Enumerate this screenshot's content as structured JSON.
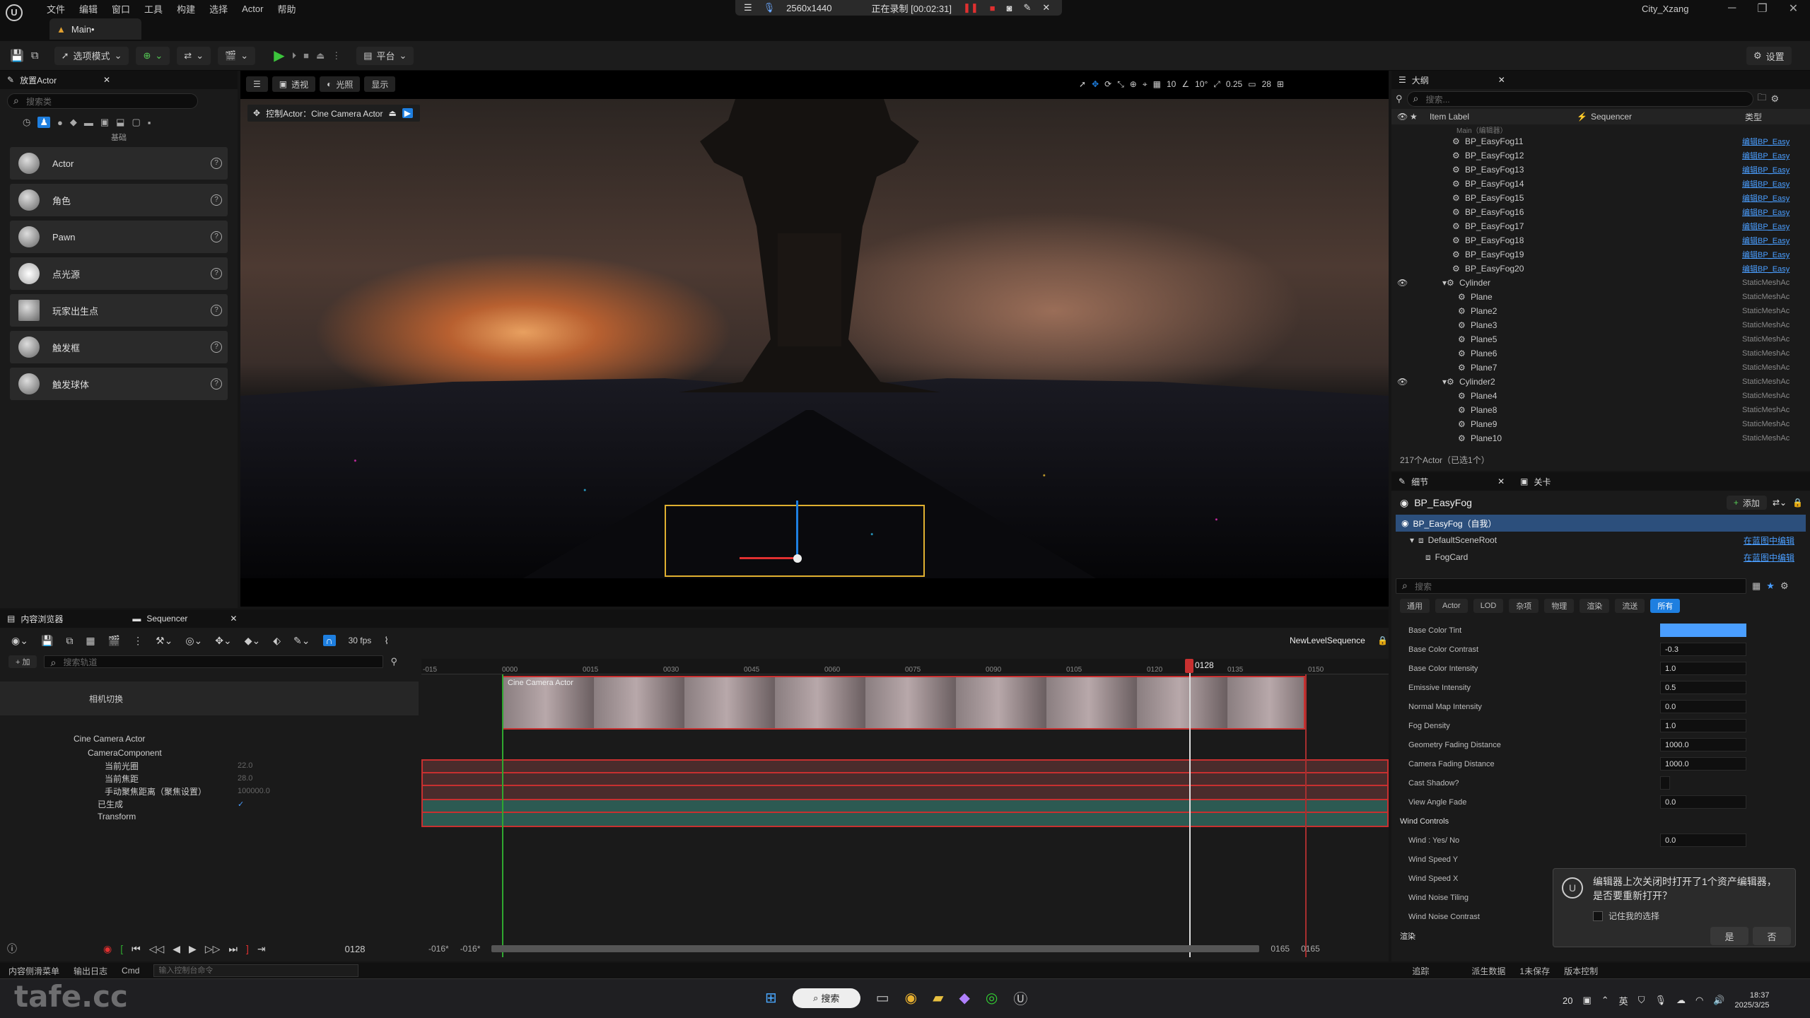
{
  "title_bar": {
    "menu": [
      "文件",
      "编辑",
      "窗口",
      "工具",
      "构建",
      "选择",
      "Actor",
      "帮助"
    ],
    "tab": "Main•",
    "recording": {
      "resolution": "2560x1440",
      "status": "正在录制 [00:02:31]"
    },
    "project": "City_Xzang"
  },
  "toolbar": {
    "mode": "选项模式",
    "platform": "平台",
    "settings": "设置"
  },
  "place_actors": {
    "tab": "放置Actor",
    "search_placeholder": "搜索类",
    "category": "基础",
    "items": [
      {
        "label": "Actor"
      },
      {
        "label": "角色"
      },
      {
        "label": "Pawn"
      },
      {
        "label": "点光源"
      },
      {
        "label": "玩家出生点"
      },
      {
        "label": "触发框"
      },
      {
        "label": "触发球体"
      }
    ]
  },
  "viewport": {
    "perspective": "透视",
    "lit": "光照",
    "show": "显示",
    "pilot": "控制Actor：Cine Camera Actor",
    "grid": "10",
    "angle": "10°",
    "scale": "0.25",
    "speed": "28"
  },
  "outliner": {
    "tab": "大纲",
    "search_placeholder": "搜索...",
    "col_label": "Item Label",
    "col_seq": "Sequencer",
    "col_type": "类型",
    "group": "Main（编辑器）",
    "rows": [
      {
        "name": "BP_EasyFog11",
        "type": "编辑BP_Easy",
        "link": true,
        "indent": 2
      },
      {
        "name": "BP_EasyFog12",
        "type": "编辑BP_Easy",
        "link": true,
        "indent": 2
      },
      {
        "name": "BP_EasyFog13",
        "type": "编辑BP_Easy",
        "link": true,
        "indent": 2
      },
      {
        "name": "BP_EasyFog14",
        "type": "编辑BP_Easy",
        "link": true,
        "indent": 2
      },
      {
        "name": "BP_EasyFog15",
        "type": "编辑BP_Easy",
        "link": true,
        "indent": 2
      },
      {
        "name": "BP_EasyFog16",
        "type": "编辑BP_Easy",
        "link": true,
        "indent": 2
      },
      {
        "name": "BP_EasyFog17",
        "type": "编辑BP_Easy",
        "link": true,
        "indent": 2
      },
      {
        "name": "BP_EasyFog18",
        "type": "编辑BP_Easy",
        "link": true,
        "indent": 2
      },
      {
        "name": "BP_EasyFog19",
        "type": "编辑BP_Easy",
        "link": true,
        "indent": 2
      },
      {
        "name": "BP_EasyFog20",
        "type": "编辑BP_Easy",
        "link": true,
        "indent": 2
      },
      {
        "name": "Cylinder",
        "type": "StaticMeshAc",
        "link": false,
        "indent": 1
      },
      {
        "name": "Plane",
        "type": "StaticMeshAc",
        "link": false,
        "indent": 3
      },
      {
        "name": "Plane2",
        "type": "StaticMeshAc",
        "link": false,
        "indent": 3
      },
      {
        "name": "Plane3",
        "type": "StaticMeshAc",
        "link": false,
        "indent": 3
      },
      {
        "name": "Plane5",
        "type": "StaticMeshAc",
        "link": false,
        "indent": 3
      },
      {
        "name": "Plane6",
        "type": "StaticMeshAc",
        "link": false,
        "indent": 3
      },
      {
        "name": "Plane7",
        "type": "StaticMeshAc",
        "link": false,
        "indent": 3
      },
      {
        "name": "Cylinder2",
        "type": "StaticMeshAc",
        "link": false,
        "indent": 1
      },
      {
        "name": "Plane4",
        "type": "StaticMeshAc",
        "link": false,
        "indent": 3
      },
      {
        "name": "Plane8",
        "type": "StaticMeshAc",
        "link": false,
        "indent": 3
      },
      {
        "name": "Plane9",
        "type": "StaticMeshAc",
        "link": false,
        "indent": 3
      },
      {
        "name": "Plane10",
        "type": "StaticMeshAc",
        "link": false,
        "indent": 3
      }
    ],
    "footer": "217个Actor（已选1个）"
  },
  "details": {
    "tab": "细节",
    "tab2": "关卡",
    "object": "BP_EasyFog",
    "add": "添加",
    "components": [
      {
        "name": "BP_EasyFog（自我）",
        "link": ""
      },
      {
        "name": "DefaultSceneRoot",
        "link": "在蓝图中编辑"
      },
      {
        "name": "FogCard",
        "link": "在蓝图中编辑"
      }
    ],
    "search_placeholder": "搜索",
    "filters": [
      "通用",
      "Actor",
      "LOD",
      "杂项",
      "物理",
      "渲染",
      "流送",
      "所有"
    ],
    "props": [
      {
        "label": "Base Color Tint",
        "value": ""
      },
      {
        "label": "Base Color Contrast",
        "value": "-0.3"
      },
      {
        "label": "Base Color Intensity",
        "value": "1.0"
      },
      {
        "label": "Emissive Intensity",
        "value": "0.5"
      },
      {
        "label": "Normal Map Intensity",
        "value": "0.0"
      },
      {
        "label": "Fog Density",
        "value": "1.0"
      },
      {
        "label": "Geometry Fading Distance",
        "value": "1000.0"
      },
      {
        "label": "Camera Fading Distance",
        "value": "1000.0"
      },
      {
        "label": "Cast Shadow?",
        "value": ""
      },
      {
        "label": "View Angle Fade",
        "value": "0.0"
      }
    ],
    "wind_section": "Wind Controls",
    "wind_props": [
      {
        "label": "Wind : Yes/ No",
        "value": "0.0"
      },
      {
        "label": "Wind Speed Y",
        "value": ""
      },
      {
        "label": "Wind Speed X",
        "value": ""
      },
      {
        "label": "Wind Noise Tiling",
        "value": ""
      },
      {
        "label": "Wind Noise Contrast",
        "value": ""
      }
    ],
    "render_section": "渲染"
  },
  "sequencer": {
    "tab_content": "内容浏览器",
    "tab_seq": "Sequencer",
    "fps": "30 fps",
    "seq_name": "NewLevelSequence",
    "add": "+ 加",
    "search_placeholder": "搜索轨道",
    "tracks": [
      {
        "label": "相机切换",
        "value": ""
      },
      {
        "label": "Cine Camera Actor",
        "value": ""
      },
      {
        "label": "CameraComponent",
        "value": ""
      },
      {
        "label": "当前光圈",
        "value": "22.0"
      },
      {
        "label": "当前焦距",
        "value": "28.0"
      },
      {
        "label": "手动聚焦距离（聚焦设置）",
        "value": "100000.0"
      },
      {
        "label": "已生成",
        "value": "✓"
      },
      {
        "label": "Transform",
        "value": ""
      }
    ],
    "ticks": [
      "-015",
      "0000",
      "0015",
      "0030",
      "0045",
      "0060",
      "0075",
      "0090",
      "0105",
      "0120",
      "0135",
      "0150"
    ],
    "current_frame": "0128",
    "playhead_label": "0128",
    "range_start": "-016*",
    "range_start2": "-016*",
    "range_end": "0165",
    "range_end2": "0165",
    "shot_label": "Cine Camera Actor"
  },
  "notification": {
    "text": "编辑器上次关闭时打开了1个资产编辑器，是否要重新打开？",
    "remember": "记住我的选择",
    "yes": "是",
    "no": "否"
  },
  "statusbar": {
    "drawer": "内容侧滑菜单",
    "log": "输出日志",
    "cmd": "Cmd",
    "cmd_placeholder": "输入控制台命令",
    "trace": "追踪",
    "derived": "派生数据",
    "unsaved": "1未保存",
    "source": "版本控制"
  },
  "taskbar": {
    "search": "搜索",
    "time": "18:37",
    "date": "2025/3/25",
    "lang": "英",
    "temp": "20"
  },
  "watermark": "tafe.cc",
  "colors": {
    "accent": "#1e7fe0",
    "link": "#4a9eff",
    "record": "#e03030",
    "selected": "#2c4f7c"
  }
}
